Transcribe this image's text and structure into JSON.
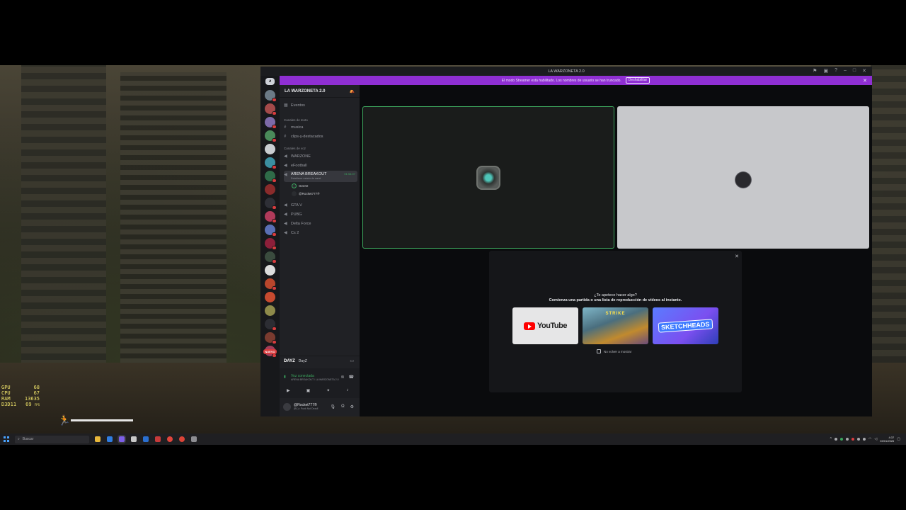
{
  "window": {
    "title": "LA WARZONETA 2.0"
  },
  "banner": {
    "text": "El modo Streamer está habilitado. Los nombres de usuario se han truncado.",
    "button": "Deshabilitar",
    "color": "#8f2fd3"
  },
  "server": {
    "name": "LA WARZONETA 2.0",
    "events": "Eventos",
    "text_category": "Canales de texto",
    "text_channels": [
      "musica",
      "clips-y-destacados"
    ],
    "voice_category": "Canales de voz",
    "voice_channels": [
      "WARZONE",
      "eFootball",
      "ARENA BREAKOUT",
      "GTA V",
      "PUBG",
      "Delta Force",
      "Cs 2"
    ],
    "active_channel": {
      "name": "ARENA BREAKOUT",
      "time": "01:54:07",
      "status": "Establecer estado de canal",
      "members": [
        "Geertz",
        "@Rocket777®"
      ]
    }
  },
  "guilds": {
    "new_label": "NUEVO"
  },
  "game_activity": {
    "logo": "DAYZ",
    "name": "DayZ"
  },
  "voice_status": {
    "connected": "Voz conectada",
    "location": "ARENA BREAKOUT / LA WARZONETA 2.0"
  },
  "user": {
    "name": "@Rocket777®",
    "status": "(BL) • Punk Not Dead!"
  },
  "activities": {
    "prompt": "¿Te apetece hacer algo?",
    "subtitle": "Comienza una partida o una lista de reproducción de vídeos al instante.",
    "cards": [
      "YouTube",
      "STRIKE",
      "SKETCHHEADS"
    ],
    "dont_show": "No volver a mostrar"
  },
  "overlay": {
    "stats": [
      {
        "label": "GPU",
        "value": "68"
      },
      {
        "label": "CPU",
        "value": "67"
      },
      {
        "label": "RAM",
        "value": "13635"
      },
      {
        "label": "D3D11",
        "value": "69"
      }
    ],
    "fps_unit": "FPS"
  },
  "taskbar": {
    "search_placeholder": "Buscar",
    "time": "4:37",
    "date": "03/01/2026"
  }
}
